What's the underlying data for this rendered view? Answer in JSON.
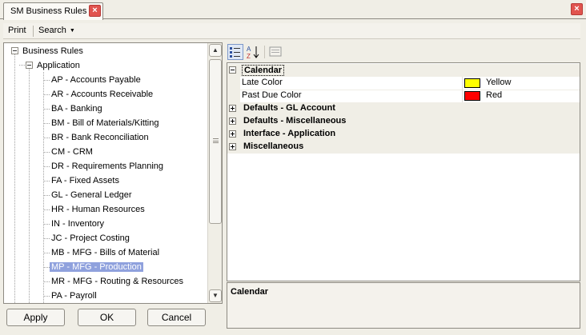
{
  "window": {
    "tab_title": "SM Business Rules"
  },
  "toolbar": {
    "print_label": "Print",
    "search_label": "Search"
  },
  "tree": {
    "root": "Business Rules",
    "group": "Application",
    "items": [
      "AP - Accounts Payable",
      "AR - Accounts Receivable",
      "BA - Banking",
      "BM - Bill of Materials/Kitting",
      "BR - Bank Reconciliation",
      "CM - CRM",
      "DR - Requirements Planning",
      "FA - Fixed Assets",
      "GL - General Ledger",
      "HR - Human Resources",
      "IN - Inventory",
      "JC - Project Costing",
      "MB - MFG - Bills of Material",
      "MP - MFG - Production",
      "MR - MFG - Routing & Resources",
      "PA - Payroll"
    ],
    "selected_item": "MP - MFG - Production"
  },
  "buttons": {
    "apply": "Apply",
    "ok": "OK",
    "cancel": "Cancel"
  },
  "property_grid": {
    "categories": [
      {
        "label": "Calendar",
        "expanded": true,
        "properties": [
          {
            "name": "Late Color",
            "value": "Yellow",
            "color": "#ffff00"
          },
          {
            "name": "Past Due Color",
            "value": "Red",
            "color": "#ff0000"
          }
        ]
      },
      {
        "label": "Defaults - GL Account",
        "expanded": false
      },
      {
        "label": "Defaults - Miscellaneous",
        "expanded": false
      },
      {
        "label": "Interface - Application",
        "expanded": false
      },
      {
        "label": "Miscellaneous",
        "expanded": false
      }
    ],
    "description_title": "Calendar"
  },
  "colors": {
    "selection": "#8fa1dd",
    "chrome": "#f0eee6",
    "close_button": "#e1544f"
  }
}
